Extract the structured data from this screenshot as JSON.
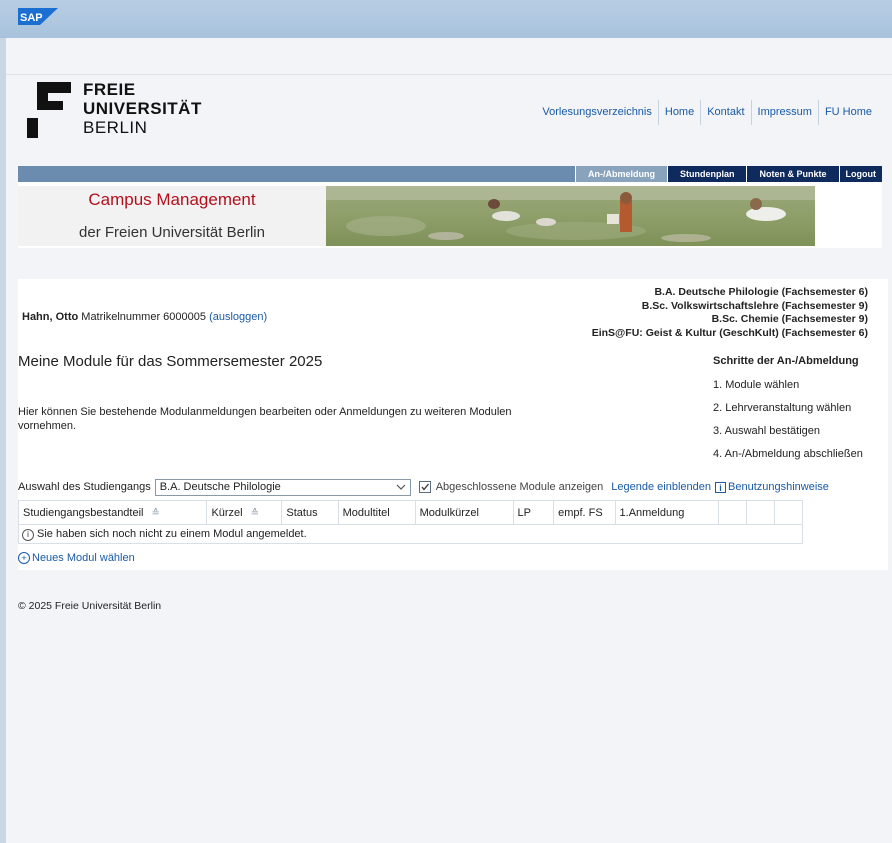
{
  "sap": {
    "logo_text": "SAP"
  },
  "university": {
    "line1": "FREIE",
    "line2": "UNIVERSITÄT",
    "line3": "BERLIN"
  },
  "topnav": [
    "Vorlesungsverzeichnis",
    "Home",
    "Kontakt",
    "Impressum",
    "FU Home"
  ],
  "menu": [
    "An-/Abmeldung",
    "Stundenplan",
    "Noten & Punkte",
    "Logout"
  ],
  "banner": {
    "title": "Campus Management",
    "subtitle": "der Freien Universität Berlin"
  },
  "user": {
    "name": "Hahn, Otto",
    "matrikel": "Matrikelnummer 6000005",
    "logout": "(ausloggen)"
  },
  "programs": [
    "B.A. Deutsche Philologie (Fachsemester 6)",
    "B.Sc. Volkswirtschaftslehre (Fachsemester 9)",
    "B.Sc. Chemie (Fachsemester 9)",
    "EinS@FU: Geist & Kultur (GeschKult) (Fachsemester 6)"
  ],
  "heading": "Meine Module für das Sommersemester 2025",
  "description": "Hier können Sie bestehende Modulanmeldungen bearbeiten oder Anmeldungen zu weiteren Modulen vornehmen.",
  "steps": {
    "title": "Schritte der An-/Abmeldung",
    "items": [
      "1. Module wählen",
      "2. Lehrveranstaltung wählen",
      "3. Auswahl bestätigen",
      "4. An-/Abmeldung abschließen"
    ]
  },
  "filter": {
    "label": "Auswahl des Studiengangs",
    "selected": "B.A. Deutsche Philologie",
    "checkbox_label": "Abgeschlossene Module anzeigen",
    "legend_link": "Legende einblenden",
    "help_link": "Benutzungshinweise",
    "info_glyph": "i"
  },
  "table": {
    "columns": [
      "Studiengangsbestandteil",
      "Kürzel",
      "Status",
      "Modultitel",
      "Modulkürzel",
      "LP",
      "empf. FS",
      "1.Anmeldung",
      "",
      "",
      ""
    ],
    "empty_message": "Sie haben sich noch nicht zu einem Modul angemeldet."
  },
  "new_module": "Neues Modul wählen",
  "footer": "© 2025 Freie Universität Berlin",
  "colors": {
    "accent_blue": "#1a5aa6",
    "brand_red": "#b2101d",
    "menu_dark": "#0f2a5c"
  }
}
